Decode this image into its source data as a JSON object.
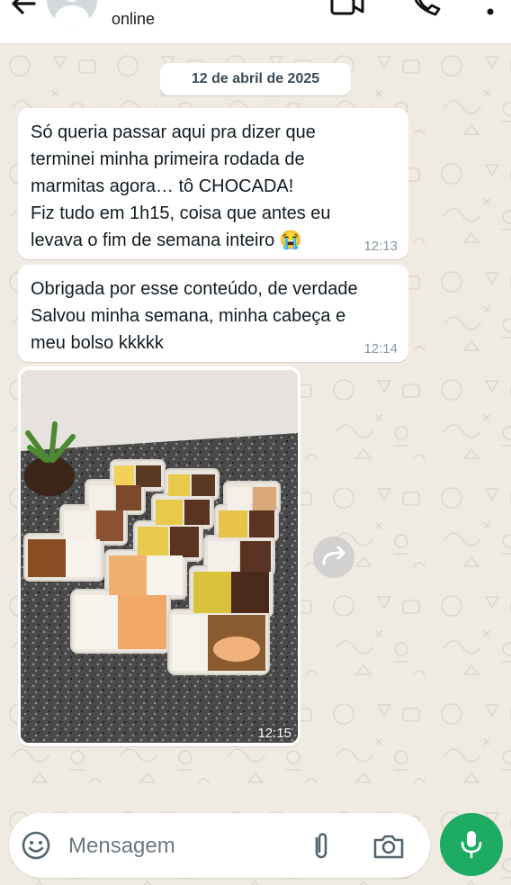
{
  "header": {
    "status": "online",
    "icons": [
      "back-arrow-icon",
      "avatar",
      "video-call-icon",
      "voice-call-icon",
      "more-options-icon"
    ]
  },
  "chat": {
    "date": "12 de abril de 2025",
    "messages": [
      {
        "text": "Só queria passar aqui pra dizer que\nterminei minha primeira rodada de\nmarmitas agora… tô CHOCADA!\nFiz tudo em 1h15, coisa que antes eu\nlevava o fim de semana inteiro 😭",
        "time": "12:13"
      },
      {
        "text": "Obrigada por esse conteúdo, de verdade\nSalvou minha semana, minha cabeça e\nmeu bolso kkkkk",
        "time": "12:14"
      }
    ],
    "photo_message": {
      "time": "12:15"
    }
  },
  "composer": {
    "placeholder": "Mensagem",
    "icons": [
      "emoji-icon",
      "attach-icon",
      "camera-icon",
      "mic-icon"
    ]
  },
  "colors": {
    "background": "#efeae2",
    "bubble": "#ffffff",
    "time_text": "#8696a0",
    "mic_button": "#1daa61"
  }
}
